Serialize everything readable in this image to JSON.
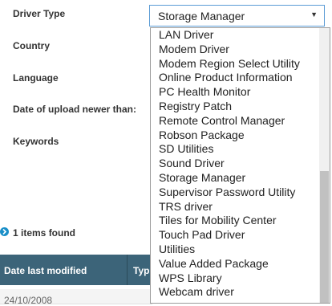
{
  "filters": {
    "driver_type_label": "Driver Type",
    "country_label": "Country",
    "language_label": "Language",
    "date_label": "Date of upload newer than:",
    "keywords_label": "Keywords",
    "driver_type_select": {
      "selected": "Storage Manager",
      "arrow": "▼"
    }
  },
  "dropdown": {
    "options": [
      "LAN Driver",
      "Modem Driver",
      "Modem Region Select Utility",
      "Online Product Information",
      "PC Health Monitor",
      "Registry Patch",
      "Remote Control Manager",
      "Robson Package",
      "SD Utilities",
      "Sound Driver",
      "Storage Manager",
      "Supervisor Password Utility",
      "TRS driver",
      "Tiles for Mobility Center",
      "Touch Pad Driver",
      "Utilities",
      "Value Added Package",
      "WPS Library",
      "Webcam driver"
    ]
  },
  "results": {
    "items_found": "1 items found",
    "columns": [
      "Date last modified",
      "Typ"
    ],
    "first_row_clipped": "24/10/2008"
  },
  "colors": {
    "header_bg": "#3c6479",
    "accent_blue": "#1a8fc8",
    "select_border": "#5b9bd5"
  }
}
